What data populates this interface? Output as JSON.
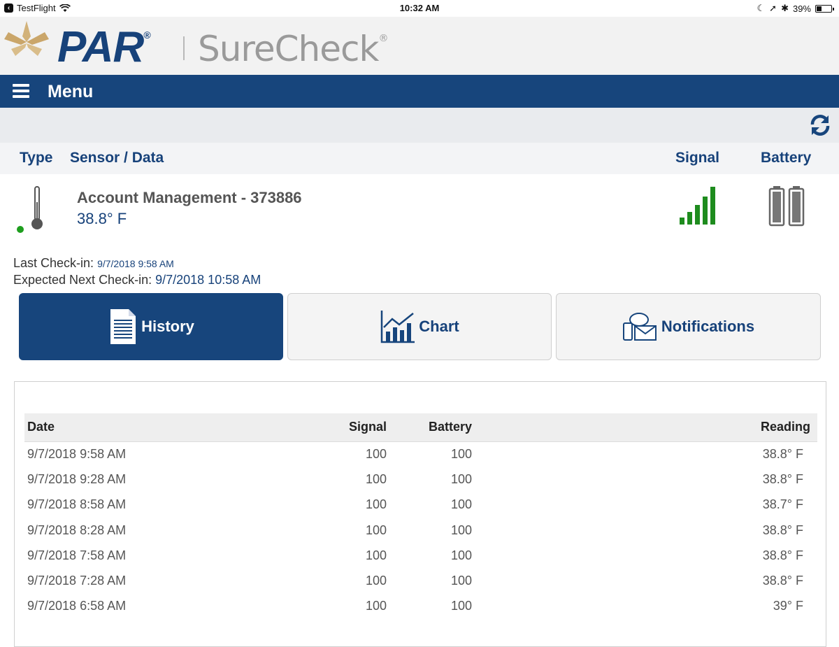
{
  "status_bar": {
    "app": "TestFlight",
    "time": "10:32 AM",
    "battery": "39%"
  },
  "brand": {
    "par": "PAR",
    "product": "SureCheck",
    "mark": "®"
  },
  "menu": {
    "label": "Menu"
  },
  "columns": {
    "type": "Type",
    "sensor_data": "Sensor / Data",
    "signal": "Signal",
    "battery": "Battery"
  },
  "sensor": {
    "name": "Account Management - 373886",
    "value": "38.8° F",
    "signal_level": 5,
    "signal_max": 5,
    "status_color": "#1e9e1e"
  },
  "checkin": {
    "last_label": "Last Check-in:",
    "last_value": "9/7/2018 9:58 AM",
    "next_label": "Expected Next Check-in:",
    "next_value": "9/7/2018 10:58 AM"
  },
  "tabs": [
    {
      "label": "History",
      "icon": "document-icon",
      "active": true
    },
    {
      "label": "Chart",
      "icon": "chart-icon",
      "active": false
    },
    {
      "label": "Notifications",
      "icon": "notifications-icon",
      "active": false
    }
  ],
  "history": {
    "headers": {
      "date": "Date",
      "signal": "Signal",
      "battery": "Battery",
      "reading": "Reading"
    },
    "rows": [
      {
        "date": "9/7/2018 9:58 AM",
        "signal": "100",
        "battery": "100",
        "reading": "38.8° F"
      },
      {
        "date": "9/7/2018 9:28 AM",
        "signal": "100",
        "battery": "100",
        "reading": "38.8° F"
      },
      {
        "date": "9/7/2018 8:58 AM",
        "signal": "100",
        "battery": "100",
        "reading": "38.7° F"
      },
      {
        "date": "9/7/2018 8:28 AM",
        "signal": "100",
        "battery": "100",
        "reading": "38.8° F"
      },
      {
        "date": "9/7/2018 7:58 AM",
        "signal": "100",
        "battery": "100",
        "reading": "38.8° F"
      },
      {
        "date": "9/7/2018 7:28 AM",
        "signal": "100",
        "battery": "100",
        "reading": "38.8° F"
      },
      {
        "date": "9/7/2018 6:58 AM",
        "signal": "100",
        "battery": "100",
        "reading": "39° F"
      }
    ]
  },
  "colors": {
    "brand_blue": "#17457c",
    "signal_green": "#1e8c1e",
    "leaf_gold": "#d2b27a"
  }
}
